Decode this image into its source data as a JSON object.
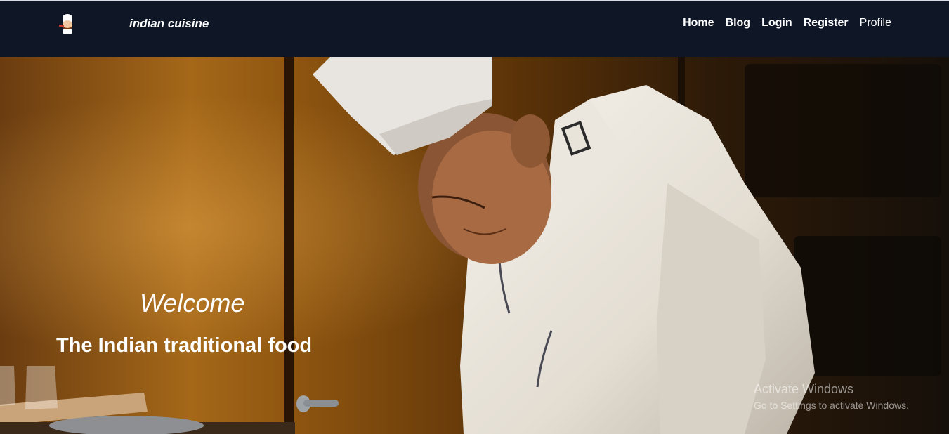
{
  "header": {
    "logo_icon": "chef-logo-icon",
    "brand": "indian cuisine",
    "nav": [
      "Home",
      "Blog",
      "Login",
      "Register",
      "Profile"
    ]
  },
  "hero": {
    "welcome": "Welcome",
    "tagline": "The Indian traditional food",
    "image_icon": "chef-photo"
  },
  "watermark": {
    "title": "Activate Windows",
    "subtitle": "Go to Settings to activate Windows."
  },
  "colors": {
    "navbar_bg": "#0f1727",
    "text": "#ffffff"
  }
}
